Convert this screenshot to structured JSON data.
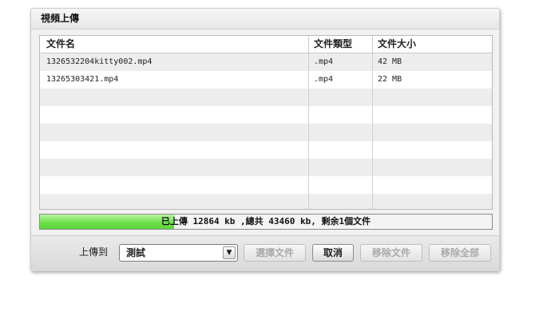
{
  "dialog": {
    "title": "視頻上傳"
  },
  "table": {
    "columns": [
      "文件名",
      "文件類型",
      "文件大小"
    ],
    "rows": [
      {
        "name": "1326532204kitty002.mp4",
        "type": ".mp4",
        "size": "42 MB"
      },
      {
        "name": "13265303421.mp4",
        "type": ".mp4",
        "size": "22 MB"
      }
    ]
  },
  "progress": {
    "text": "已上傳 12864 kb ,總共 43460 kb, 剩余1個文件",
    "fraction": 0.296
  },
  "footer": {
    "upload_to_label": "上傳到",
    "selected_folder": "測試",
    "select_files": "選擇文件",
    "cancel": "取消",
    "remove_file": "移除文件",
    "remove_all": "移除全部"
  },
  "colors": {
    "progress_fill": "#6ee04a",
    "row_alt": "#ededed"
  }
}
